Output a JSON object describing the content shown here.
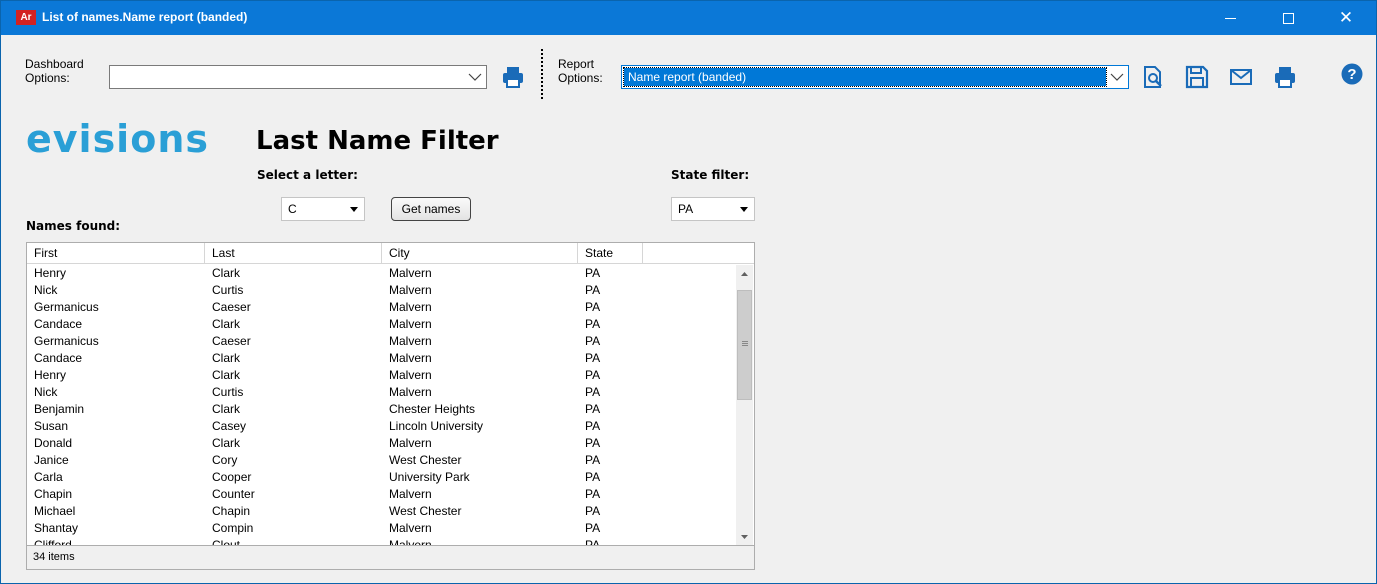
{
  "window": {
    "app_icon_text": "Ar",
    "title": "List of names.Name report (banded)"
  },
  "toolbar": {
    "dashboard_label": "Dashboard\nOptions:",
    "dashboard_value": "",
    "report_label": "Report\nOptions:",
    "report_value": "Name report (banded)"
  },
  "header": {
    "logo": "evisions",
    "title": "Last Name Filter"
  },
  "filters": {
    "letter_label": "Select a letter:",
    "letter_value": "C",
    "get_names_label": "Get names",
    "state_label": "State filter:",
    "state_value": "PA",
    "names_found_label": "Names found:"
  },
  "table": {
    "columns": [
      "First",
      "Last",
      "City",
      "State"
    ],
    "rows": [
      [
        "Henry",
        "Clark",
        "Malvern",
        "PA"
      ],
      [
        "Nick",
        "Curtis",
        "Malvern",
        "PA"
      ],
      [
        "Germanicus",
        "Caeser",
        "Malvern",
        "PA"
      ],
      [
        "Candace",
        "Clark",
        "Malvern",
        "PA"
      ],
      [
        "Germanicus",
        "Caeser",
        "Malvern",
        "PA"
      ],
      [
        "Candace",
        "Clark",
        "Malvern",
        "PA"
      ],
      [
        "Henry",
        "Clark",
        "Malvern",
        "PA"
      ],
      [
        "Nick",
        "Curtis",
        "Malvern",
        "PA"
      ],
      [
        "Benjamin",
        "Clark",
        "Chester Heights",
        "PA"
      ],
      [
        "Susan",
        "Casey",
        "Lincoln University",
        "PA"
      ],
      [
        "Donald",
        "Clark",
        "Malvern",
        "PA"
      ],
      [
        "Janice",
        "Cory",
        "West Chester",
        "PA"
      ],
      [
        "Carla",
        "Cooper",
        "University Park",
        "PA"
      ],
      [
        "Chapin",
        "Counter",
        "Malvern",
        "PA"
      ],
      [
        "Michael",
        "Chapin",
        "West Chester",
        "PA"
      ],
      [
        "Shantay",
        "Compin",
        "Malvern",
        "PA"
      ],
      [
        "Clifford",
        "Clout",
        "Malvern",
        "PA"
      ]
    ],
    "status": "34 items"
  },
  "colors": {
    "titlebar": "#0b78d7",
    "accent": "#0078d7",
    "logo": "#2a9fd6",
    "icon": "#1a6bb8"
  }
}
